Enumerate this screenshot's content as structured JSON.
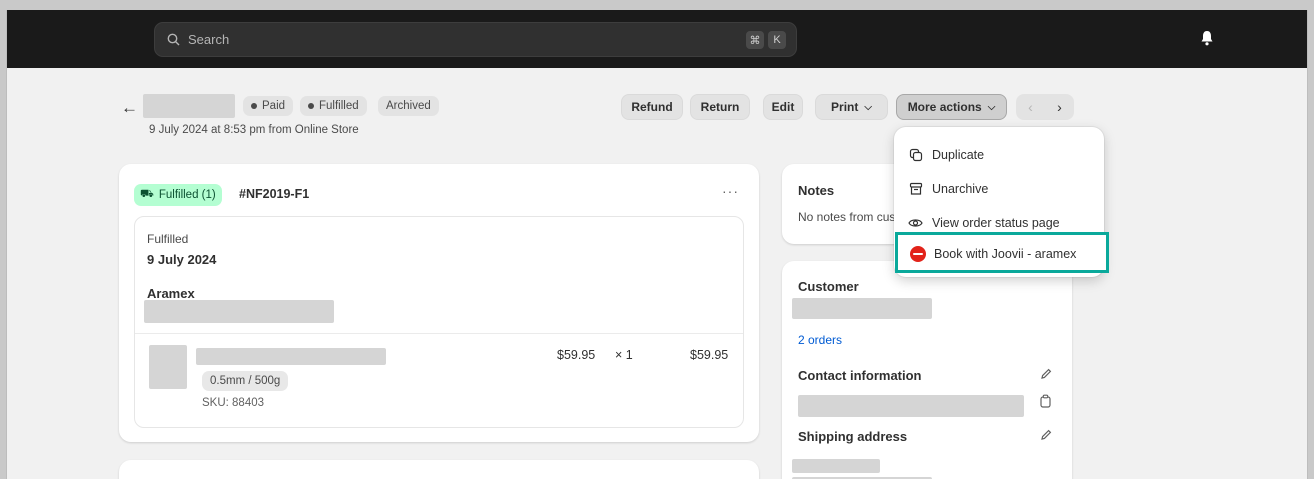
{
  "topbar": {
    "search_placeholder": "Search",
    "shortcut_keys": [
      "⌘",
      "K"
    ],
    "notification_icon": "bell-icon"
  },
  "order": {
    "badges": {
      "paid": "Paid",
      "fulfilled": "Fulfilled",
      "archived": "Archived"
    },
    "date_source": "9 July 2024 at 8:53 pm from Online Store"
  },
  "actions": {
    "refund": "Refund",
    "return": "Return",
    "edit": "Edit",
    "print": "Print",
    "more_actions": "More actions"
  },
  "more_actions_menu": {
    "items": [
      {
        "label": "Duplicate",
        "icon": "duplicate-icon"
      },
      {
        "label": "Unarchive",
        "icon": "unarchive-icon"
      },
      {
        "label": "View order status page",
        "icon": "eye-icon"
      },
      {
        "label": "Book with Joovii - aramex",
        "icon": "aramex-logo-icon",
        "highlighted": true
      }
    ],
    "highlight_color": "#0aa99b"
  },
  "fulfillment": {
    "status_badge": "Fulfilled (1)",
    "code": "#NF2019-F1",
    "status_label": "Fulfilled",
    "date": "9 July 2024",
    "carrier": "Aramex",
    "line_item": {
      "variant": "0.5mm / 500g",
      "sku": "SKU: 88403",
      "unit_price": "$59.95",
      "quantity": "× 1",
      "total": "$59.95"
    }
  },
  "notes": {
    "title": "Notes",
    "empty_text": "No notes from customer"
  },
  "customer": {
    "title": "Customer",
    "orders_link": "2 orders",
    "contact_title": "Contact information",
    "shipping_title": "Shipping address"
  },
  "colors": {
    "topbar": "#1a1a1a",
    "fulfilled_badge_bg": "#b4fed2",
    "link": "#005bd3"
  }
}
